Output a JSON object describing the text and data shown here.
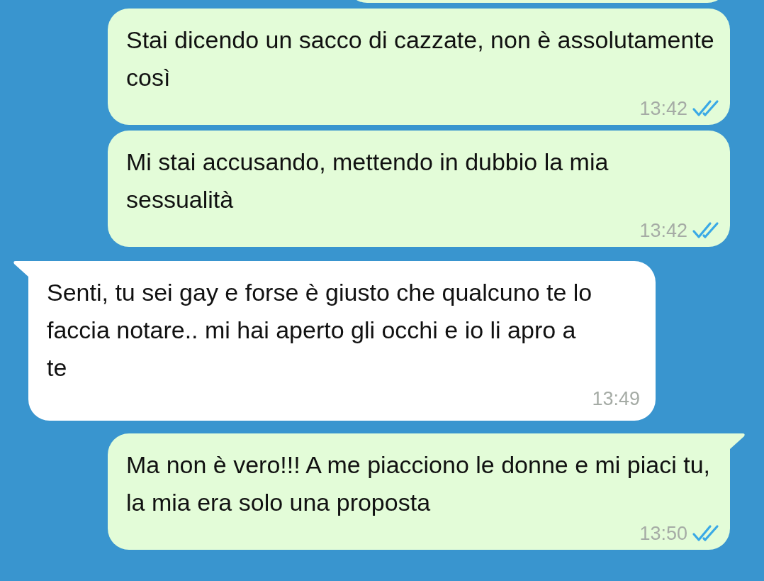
{
  "clipped_bubble_above": true,
  "messages": [
    {
      "kind": "outgoing",
      "text": "Stai dicendo un sacco di cazzate, non è assolutamente così",
      "time": "13:42",
      "read": true,
      "tail": false
    },
    {
      "kind": "outgoing",
      "text": "Mi stai accusando, mettendo in dubbio la mia sessualità",
      "time": "13:42",
      "read": true,
      "tail": false
    },
    {
      "kind": "incoming",
      "text": "Senti, tu sei gay e forse è giusto che qualcuno te lo faccia notare.. mi hai aperto gli occhi e io li apro a te",
      "time": "13:49",
      "tail": true
    },
    {
      "kind": "outgoing",
      "text": "Ma non è vero!!! A me piacciono le donne e mi piaci tu, la mia era solo una proposta",
      "time": "13:50",
      "read": true,
      "tail": true
    }
  ]
}
